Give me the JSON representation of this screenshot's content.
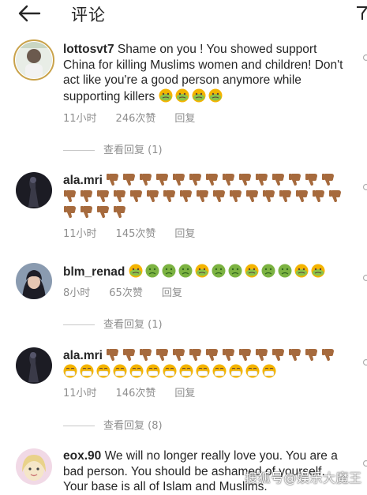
{
  "header": {
    "title": "评论",
    "back_icon": "arrow-left-icon",
    "filter_icon": "filter-icon"
  },
  "comments": [
    {
      "username": "lottosvt7",
      "text": "Shame on you ! You showed support China for killing Muslims women and children! Don't act like you're a good person anymore while supporting killers",
      "time": "11小时",
      "likes": "246次赞",
      "reply": "回复",
      "view_replies": "查看回复 (1)"
    },
    {
      "username": "ala.mri",
      "text": "",
      "time": "11小时",
      "likes": "145次赞",
      "reply": "回复"
    },
    {
      "username": "blm_renad",
      "text": "",
      "time": "8小时",
      "likes": "65次赞",
      "reply": "回复",
      "view_replies": "查看回复 (1)"
    },
    {
      "username": "ala.mri",
      "text": "",
      "time": "11小时",
      "likes": "146次赞",
      "reply": "回复",
      "view_replies": "查看回复 (8)"
    },
    {
      "username": "eox.90",
      "text": "We will no longer really love you. You are a bad person. You should be ashamed of yourself. Your base is all of Islam and Muslims."
    }
  ],
  "watermark": "搜狐号@娱乐大魔王",
  "colors": {
    "text": "#262626",
    "meta": "#8e8e8e",
    "thumb": "#b5713d",
    "nauseated": "#7cb342",
    "avatar_ring": "#c9a24a"
  }
}
